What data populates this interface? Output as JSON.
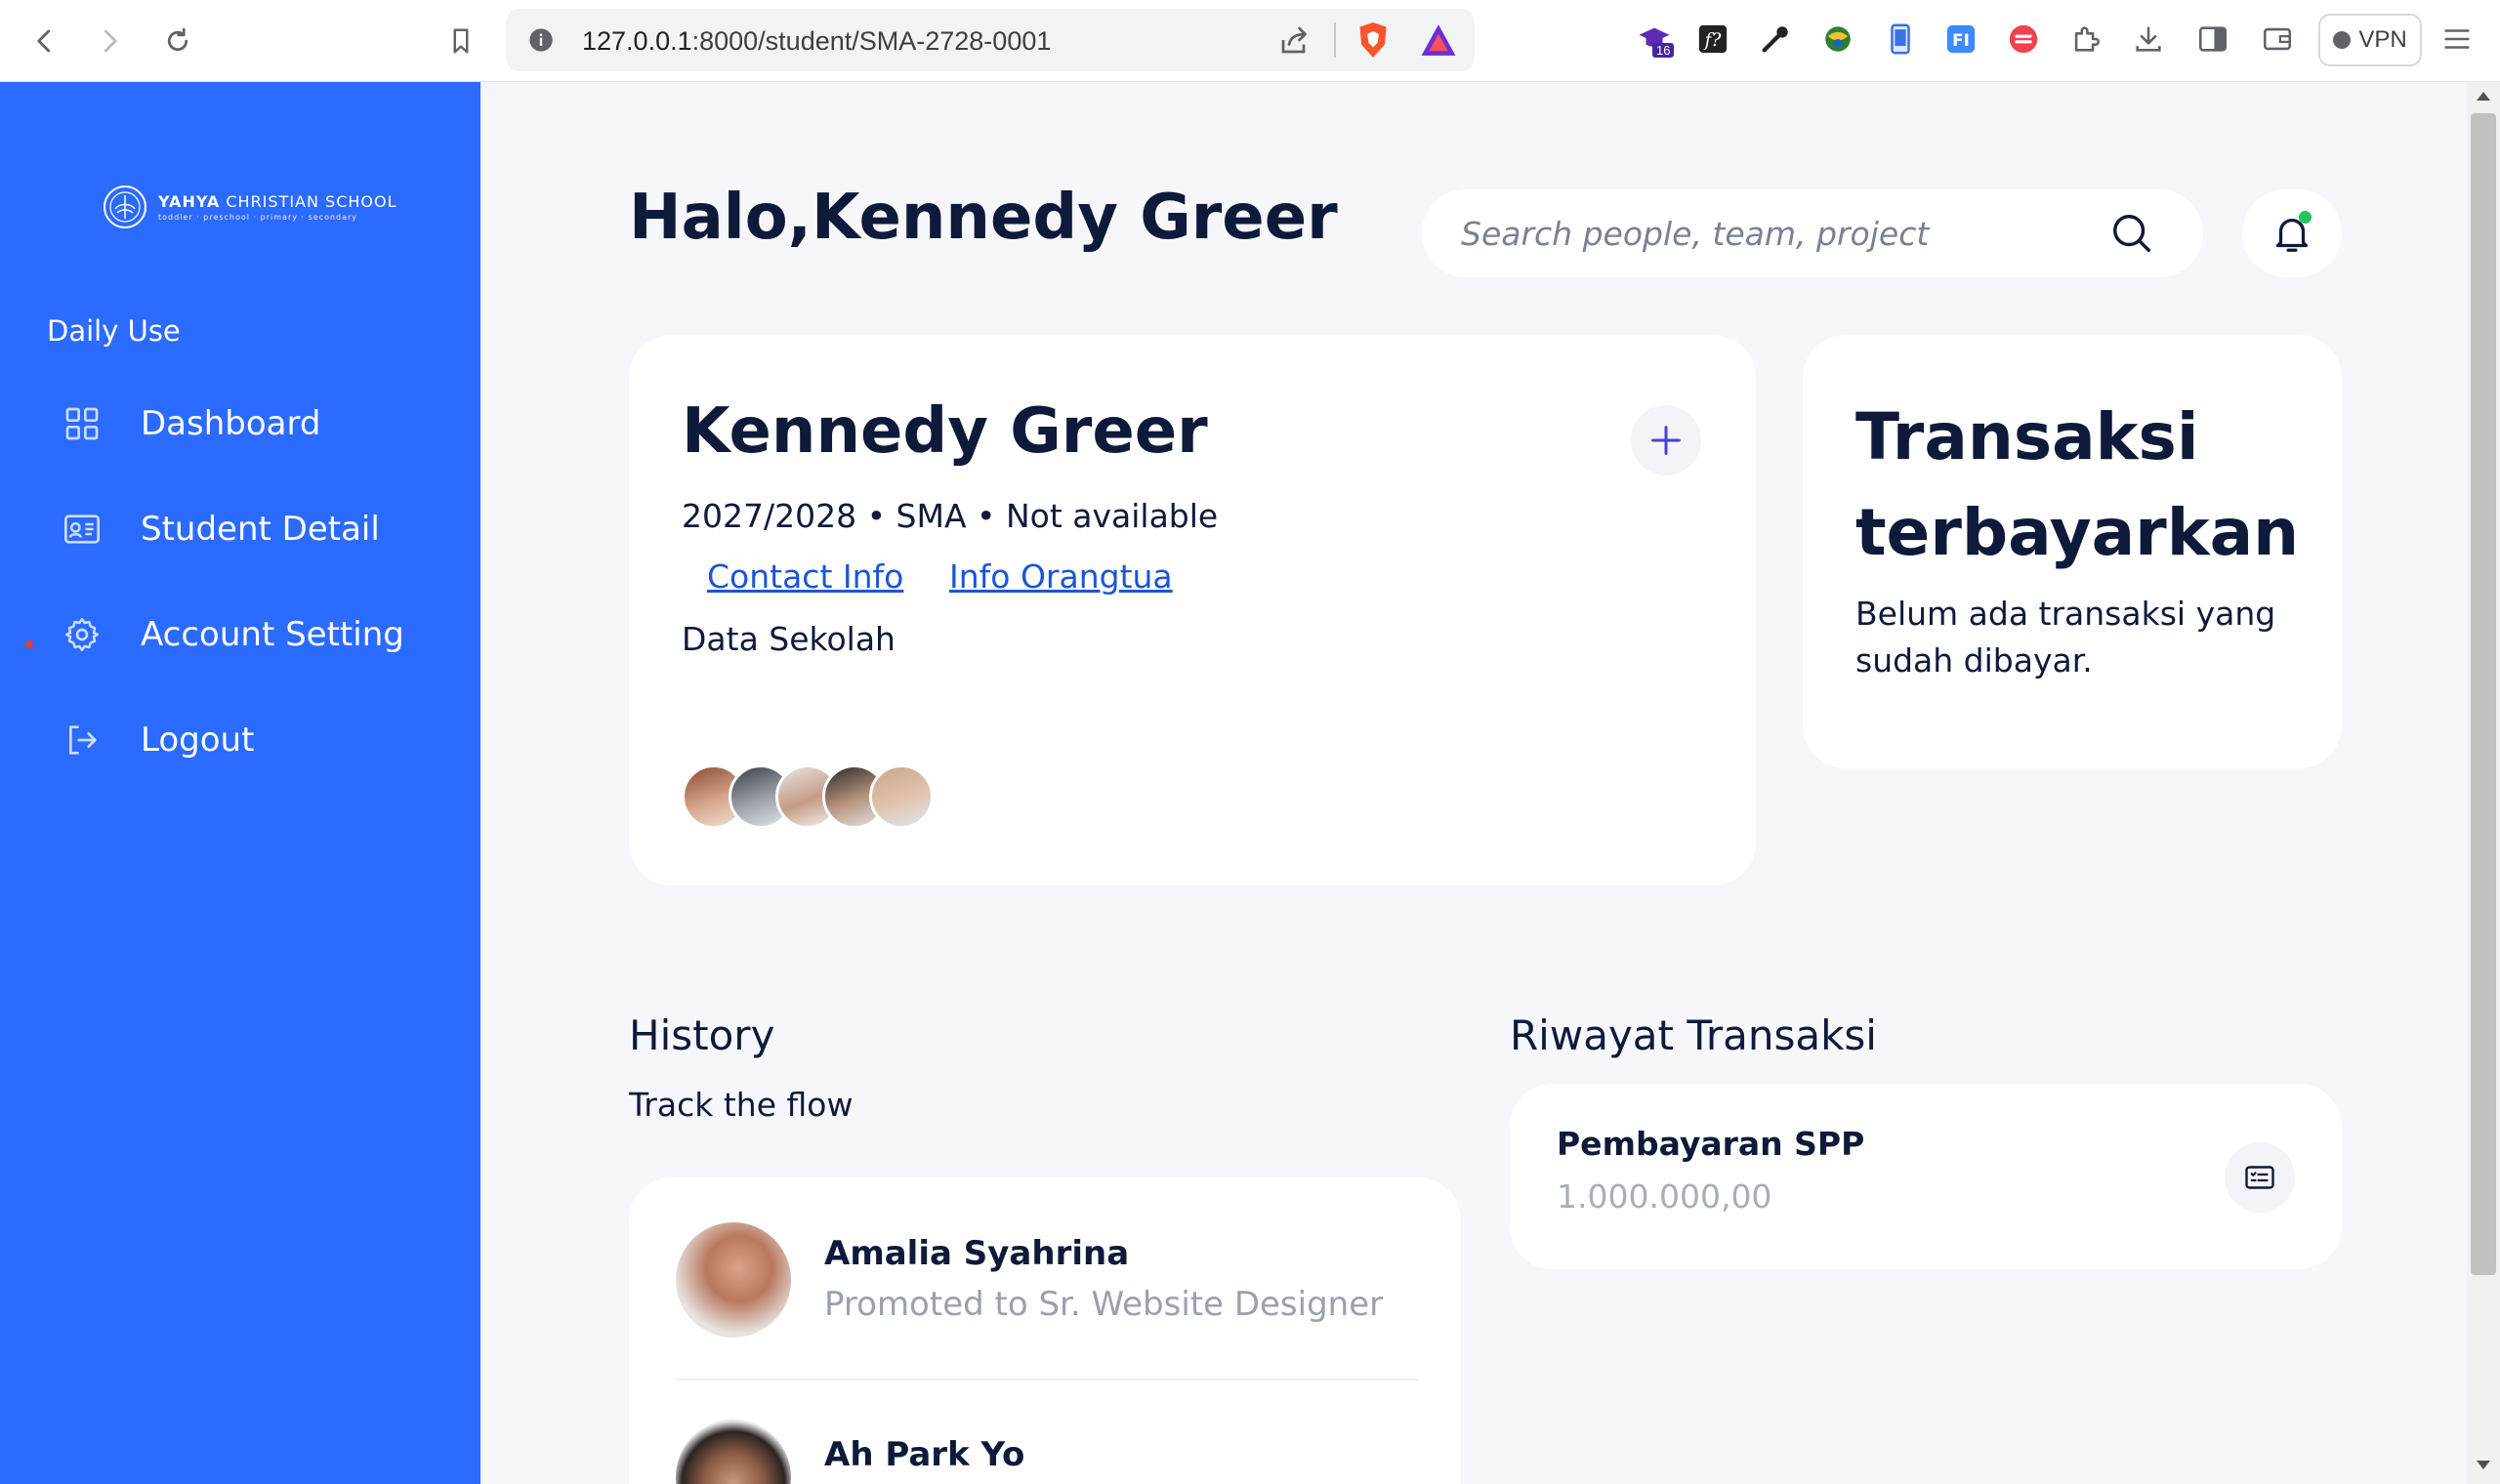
{
  "browser": {
    "url_host": "127.0.0.1",
    "url_rest": ":8000/student/SMA-2728-0001",
    "ext_badge": "16",
    "vpn_label": "VPN"
  },
  "sidebar": {
    "logo_brand": "YAHYA",
    "logo_name": "CHRISTIAN SCHOOL",
    "logo_tagline": "toddler · preschool · primary · secondary",
    "section_label": "Daily Use",
    "items": [
      {
        "label": "Dashboard",
        "icon": "grid-icon"
      },
      {
        "label": "Student Detail",
        "icon": "id-card-icon"
      },
      {
        "label": "Account Setting",
        "icon": "gear-icon"
      },
      {
        "label": "Logout",
        "icon": "logout-icon"
      }
    ]
  },
  "header": {
    "greeting": "Halo,Kennedy Greer",
    "search_placeholder": "Search people, team, project"
  },
  "student": {
    "name": "Kennedy Greer",
    "meta": "2027/2028 • SMA • Not available",
    "link_contact": "Contact Info",
    "link_parent": "Info Orangtua",
    "school_data": "Data Sekolah"
  },
  "transactions_card": {
    "title": "Transaksi terbayarkan",
    "subtitle": "Belum ada transaksi yang sudah dibayar."
  },
  "history": {
    "title": "History",
    "subtitle": "Track the flow",
    "items": [
      {
        "name": "Amalia Syahrina",
        "desc": "Promoted to Sr. Website Designer"
      },
      {
        "name": "Ah Park Yo",
        "desc": ""
      }
    ]
  },
  "riwayat": {
    "title": "Riwayat Transaksi",
    "items": [
      {
        "name": "Pembayaran SPP",
        "amount": "1.000.000,00"
      }
    ]
  },
  "colors": {
    "sidebar": "#2b6bff",
    "background": "#f6f7fb",
    "text_dark": "#0f1a3a",
    "link": "#1a55d6",
    "notification_dot": "#22c55e"
  }
}
